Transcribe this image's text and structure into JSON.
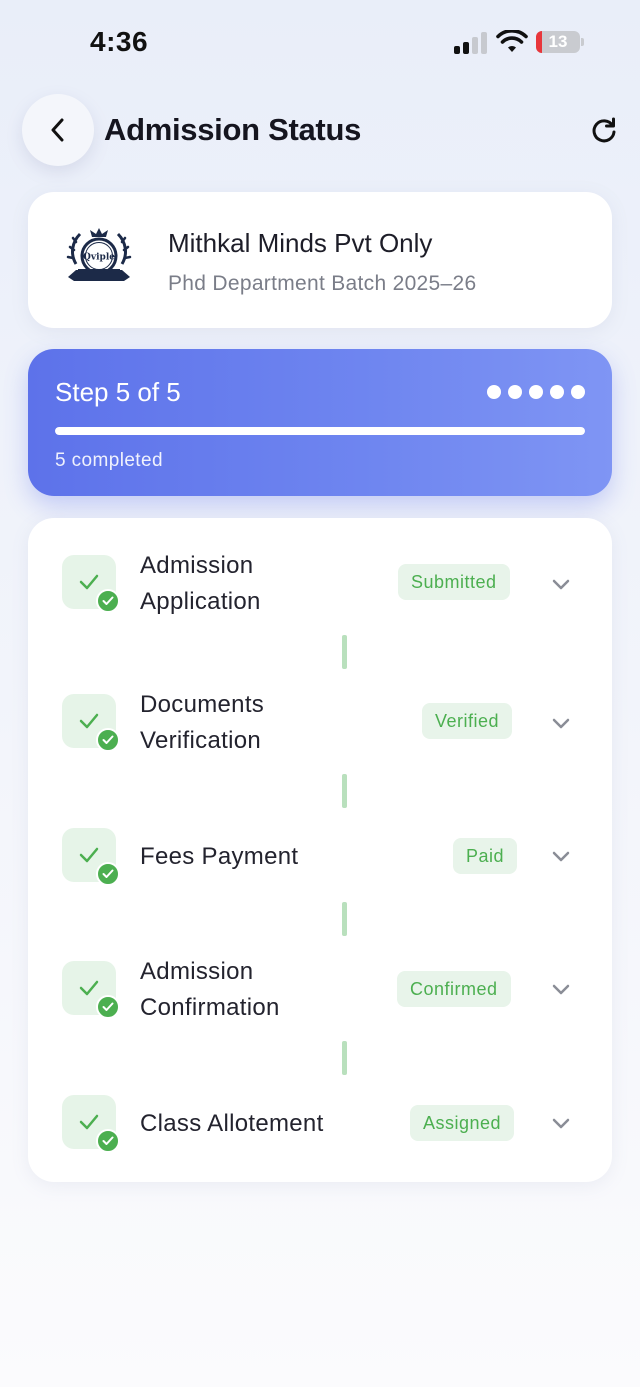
{
  "status_bar": {
    "time": "4:36",
    "battery_level": "13",
    "battery_color": "#e8363b"
  },
  "header": {
    "title": "Admission Status",
    "back_icon": "chevron-left-icon",
    "refresh_icon": "refresh-icon"
  },
  "institute": {
    "logo_text": "Qviple",
    "name": "Mithkal Minds Pvt Only",
    "subtitle": "Phd Department Batch 2025–26"
  },
  "progress": {
    "step_label": "Step 5 of 5",
    "completed_label": "5 completed",
    "completed": 5,
    "total": 5,
    "fraction": 1.0,
    "accent_color": "#5d72ea"
  },
  "stages": [
    {
      "label_line1": "Admission",
      "label_line2": "Application",
      "status": "Submitted",
      "icon": "check-icon"
    },
    {
      "label_line1": "Documents",
      "label_line2": "Verification",
      "status": "Verified",
      "icon": "check-icon"
    },
    {
      "label_line1": "Fees Payment",
      "label_line2": "",
      "status": "Paid",
      "icon": "check-icon"
    },
    {
      "label_line1": "Admission",
      "label_line2": "Confirmation",
      "status": "Confirmed",
      "icon": "check-icon"
    },
    {
      "label_line1": "Class Allotement",
      "label_line2": "",
      "status": "Assigned",
      "icon": "check-icon"
    }
  ],
  "colors": {
    "success": "#4caf50",
    "success_bg": "#e8f4ea"
  }
}
